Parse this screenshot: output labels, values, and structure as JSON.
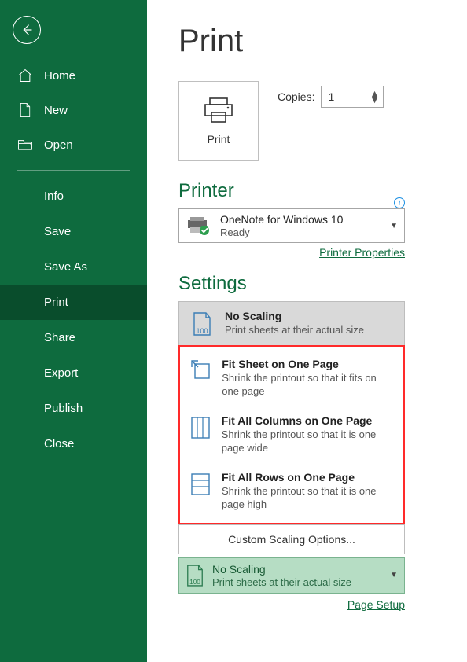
{
  "sidebar": {
    "items": [
      {
        "label": "Home"
      },
      {
        "label": "New"
      },
      {
        "label": "Open"
      },
      {
        "label": "Info"
      },
      {
        "label": "Save"
      },
      {
        "label": "Save As"
      },
      {
        "label": "Print"
      },
      {
        "label": "Share"
      },
      {
        "label": "Export"
      },
      {
        "label": "Publish"
      },
      {
        "label": "Close"
      }
    ]
  },
  "print": {
    "title": "Print",
    "print_button": "Print",
    "copies_label": "Copies:",
    "copies_value": "1",
    "printer_section": "Printer",
    "printer_name": "OneNote for Windows 10",
    "printer_status": "Ready",
    "printer_properties": "Printer Properties",
    "settings_section": "Settings",
    "scaling_options": [
      {
        "title": "No Scaling",
        "desc": "Print sheets at their actual size"
      },
      {
        "title": "Fit Sheet on One Page",
        "desc": "Shrink the printout so that it fits on one page"
      },
      {
        "title": "Fit All Columns on One Page",
        "desc": "Shrink the printout so that it is one page wide"
      },
      {
        "title": "Fit All Rows on One Page",
        "desc": "Shrink the printout so that it is one page high"
      }
    ],
    "custom_scaling": "Custom Scaling Options...",
    "current_scaling_title": "No Scaling",
    "current_scaling_desc": "Print sheets at their actual size",
    "page_setup": "Page Setup"
  }
}
